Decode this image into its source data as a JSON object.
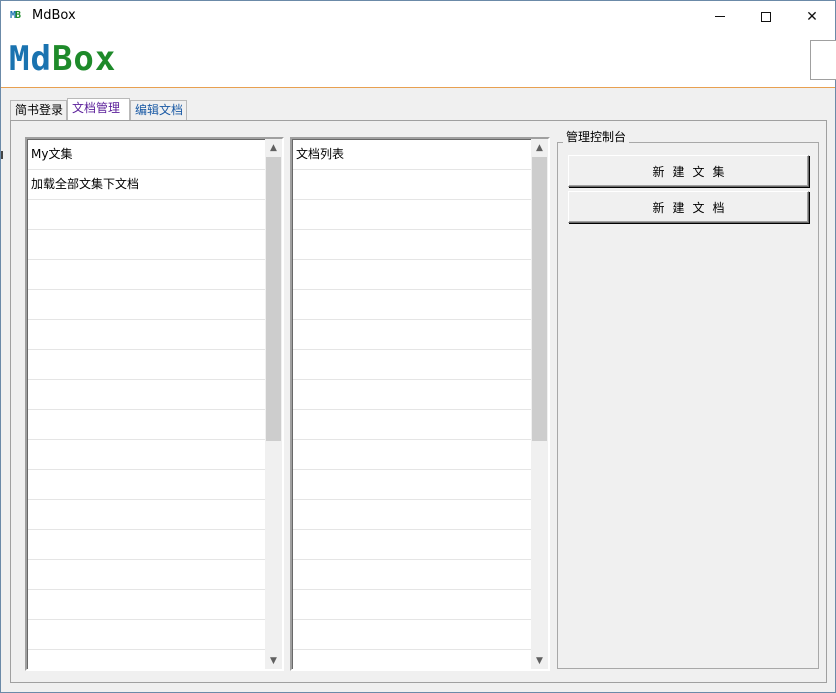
{
  "window": {
    "title": "MdBox",
    "icon_text_m": "M",
    "icon_text_b": "B"
  },
  "header": {
    "logo_m": "Md",
    "logo_b": "Box"
  },
  "tabs": [
    {
      "label": "简书登录"
    },
    {
      "label": "文档管理"
    },
    {
      "label": "编辑文档"
    }
  ],
  "collections_list": {
    "items": [
      "My文集",
      "加载全部文集下文档"
    ]
  },
  "documents_list": {
    "items": [
      "文档列表"
    ]
  },
  "console": {
    "title": "管理控制台",
    "new_collection_label": "新建文集",
    "new_document_label": "新建文档"
  },
  "icons": {
    "minimize": "minimize-icon",
    "maximize": "maximize-icon",
    "close": "close-icon",
    "scroll_up": "chevron-up-icon",
    "scroll_down": "chevron-down-icon"
  },
  "colors": {
    "logo_blue": "#1a73b0",
    "logo_green": "#1e8a2a",
    "header_divider": "#e8a050",
    "active_tab_text": "#5b1f9a",
    "tab3_text": "#1a5aa5"
  }
}
